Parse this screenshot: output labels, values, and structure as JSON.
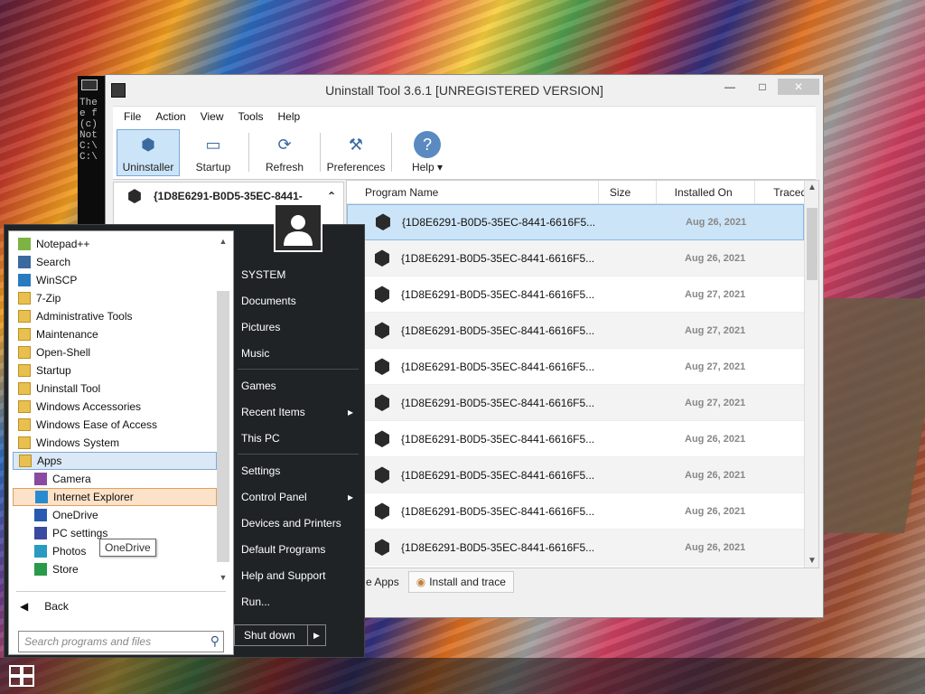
{
  "console": {
    "lines": [
      "The",
      "e f",
      "",
      "(c)",
      "Not",
      "",
      "C:\\",
      "",
      "C:\\"
    ]
  },
  "window": {
    "title": "Uninstall Tool 3.6.1 [UNREGISTERED VERSION]",
    "controls": {
      "minimize": "—",
      "maximize": "□",
      "close": "✕"
    },
    "menu": [
      "File",
      "Action",
      "View",
      "Tools",
      "Help"
    ],
    "toolbar": [
      {
        "label": "Uninstaller",
        "icon": "uninstaller-icon",
        "active": true
      },
      {
        "label": "Startup",
        "icon": "startup-icon",
        "active": false
      },
      {
        "label": "Refresh",
        "icon": "refresh-icon",
        "active": false
      },
      {
        "label": "Preferences",
        "icon": "preferences-icon",
        "active": false
      },
      {
        "label": "Help ▾",
        "icon": "help-icon",
        "active": false
      }
    ],
    "detail_title": "{1D8E6291-B0D5-35EC-8441-",
    "columns": [
      "Program Name",
      "Size",
      "Installed On",
      "Traced"
    ],
    "rows": [
      {
        "name": "{1D8E6291-B0D5-35EC-8441-6616F5...",
        "size": "",
        "date": "Aug 26, 2021"
      },
      {
        "name": "{1D8E6291-B0D5-35EC-8441-6616F5...",
        "size": "",
        "date": "Aug 26, 2021"
      },
      {
        "name": "{1D8E6291-B0D5-35EC-8441-6616F5...",
        "size": "",
        "date": "Aug 27, 2021"
      },
      {
        "name": "{1D8E6291-B0D5-35EC-8441-6616F5...",
        "size": "",
        "date": "Aug 27, 2021"
      },
      {
        "name": "{1D8E6291-B0D5-35EC-8441-6616F5...",
        "size": "",
        "date": "Aug 27, 2021"
      },
      {
        "name": "{1D8E6291-B0D5-35EC-8441-6616F5...",
        "size": "",
        "date": "Aug 27, 2021"
      },
      {
        "name": "{1D8E6291-B0D5-35EC-8441-6616F5...",
        "size": "",
        "date": "Aug 26, 2021"
      },
      {
        "name": "{1D8E6291-B0D5-35EC-8441-6616F5...",
        "size": "",
        "date": "Aug 26, 2021"
      },
      {
        "name": "{1D8E6291-B0D5-35EC-8441-6616F5...",
        "size": "",
        "date": "Aug 26, 2021"
      },
      {
        "name": "{1D8E6291-B0D5-35EC-8441-6616F5...",
        "size": "",
        "date": "Aug 26, 2021"
      }
    ],
    "bottom_tabs": [
      "e Apps",
      "Install and trace"
    ]
  },
  "start_menu": {
    "programs": [
      {
        "label": "Notepad++",
        "icon": "notepad-icon",
        "sub": false
      },
      {
        "label": "Search",
        "icon": "search-icon",
        "sub": false
      },
      {
        "label": "WinSCP",
        "icon": "winscp-icon",
        "sub": false
      },
      {
        "label": "7-Zip",
        "icon": "folder-icon",
        "sub": false
      },
      {
        "label": "Administrative Tools",
        "icon": "folder-icon",
        "sub": false
      },
      {
        "label": "Maintenance",
        "icon": "folder-icon",
        "sub": false
      },
      {
        "label": "Open-Shell",
        "icon": "folder-icon",
        "sub": false
      },
      {
        "label": "Startup",
        "icon": "folder-icon",
        "sub": false
      },
      {
        "label": "Uninstall Tool",
        "icon": "folder-icon",
        "sub": false
      },
      {
        "label": "Windows Accessories",
        "icon": "folder-icon",
        "sub": false
      },
      {
        "label": "Windows Ease of Access",
        "icon": "folder-icon",
        "sub": false
      },
      {
        "label": "Windows System",
        "icon": "folder-icon",
        "sub": false
      },
      {
        "label": "Apps",
        "icon": "apps-folder-icon",
        "sub": false,
        "state": "open"
      },
      {
        "label": "Camera",
        "icon": "camera-icon",
        "sub": true
      },
      {
        "label": "Internet Explorer",
        "icon": "ie-icon",
        "sub": true,
        "state": "hover"
      },
      {
        "label": "OneDrive",
        "icon": "onedrive-icon",
        "sub": true
      },
      {
        "label": "PC settings",
        "icon": "settings-icon",
        "sub": true
      },
      {
        "label": "Photos",
        "icon": "photos-icon",
        "sub": true
      },
      {
        "label": "Store",
        "icon": "store-icon",
        "sub": true
      }
    ],
    "back": "Back",
    "search_placeholder": "Search programs and files",
    "tooltip": "OneDrive",
    "right_items": [
      {
        "label": "SYSTEM",
        "arrow": false,
        "sep_after": false
      },
      {
        "label": "Documents",
        "arrow": false,
        "sep_after": false
      },
      {
        "label": "Pictures",
        "arrow": false,
        "sep_after": false
      },
      {
        "label": "Music",
        "arrow": false,
        "sep_after": true
      },
      {
        "label": "Games",
        "arrow": false,
        "sep_after": false
      },
      {
        "label": "Recent Items",
        "arrow": true,
        "sep_after": false
      },
      {
        "label": "This PC",
        "arrow": false,
        "sep_after": true
      },
      {
        "label": "Settings",
        "arrow": false,
        "sep_after": false
      },
      {
        "label": "Control Panel",
        "arrow": true,
        "sep_after": false
      },
      {
        "label": "Devices and Printers",
        "arrow": false,
        "sep_after": false
      },
      {
        "label": "Default Programs",
        "arrow": false,
        "sep_after": false
      },
      {
        "label": "Help and Support",
        "arrow": false,
        "sep_after": false
      },
      {
        "label": "Run...",
        "arrow": false,
        "sep_after": false
      }
    ],
    "shutdown": "Shut down"
  },
  "colors": {
    "selection": "#cce4f7",
    "hover": "#fbe2c8",
    "menu_bg": "#1f2326"
  }
}
